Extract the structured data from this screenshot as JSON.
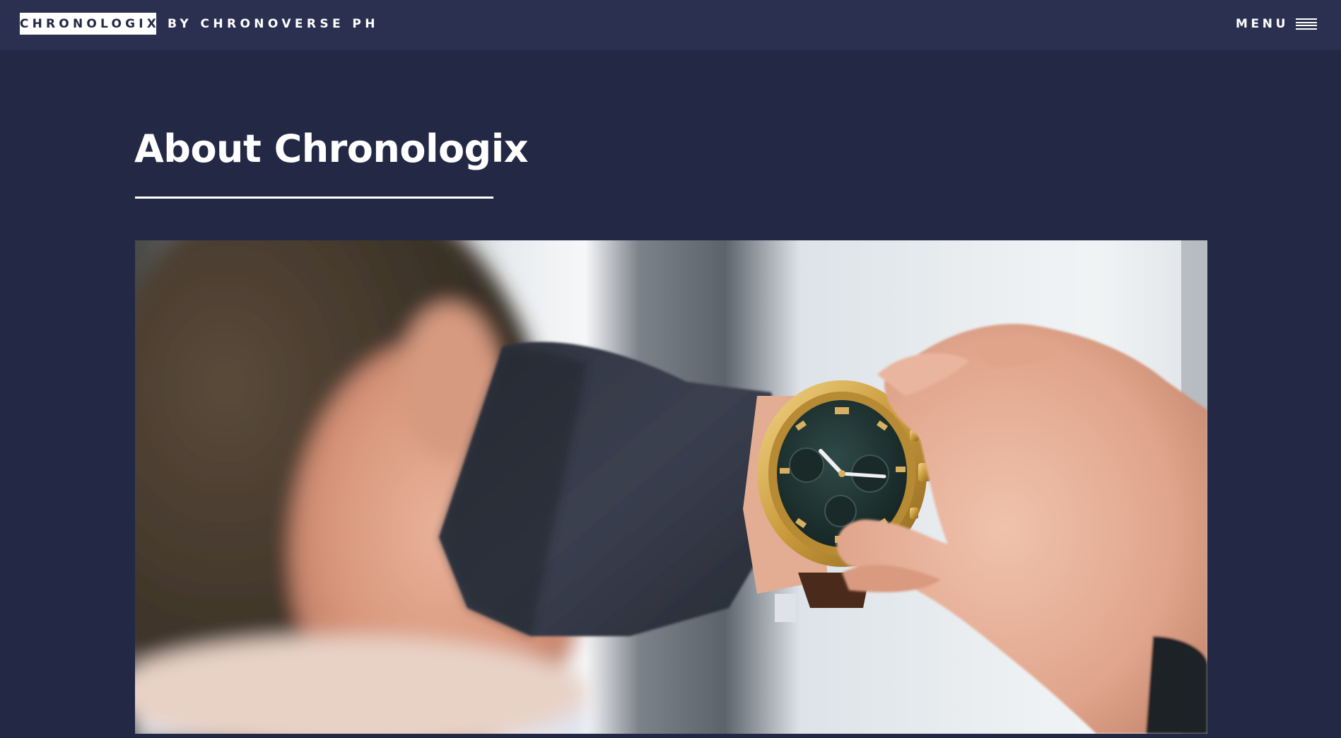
{
  "header": {
    "brand_name": "CHRONOLOGIX",
    "brand_tagline": "BY CHRONOVERSE PH",
    "menu_label": "MENU",
    "menu_icon": "hamburger-icon"
  },
  "page": {
    "title": "About Chronologix"
  },
  "hero": {
    "alt": "Man checking a gold chronograph wristwatch with a dark dial and brown leather strap"
  },
  "colors": {
    "background": "#232845",
    "header_background": "#2b3050",
    "text": "#ffffff",
    "accent_gold": "#c99a3a"
  }
}
